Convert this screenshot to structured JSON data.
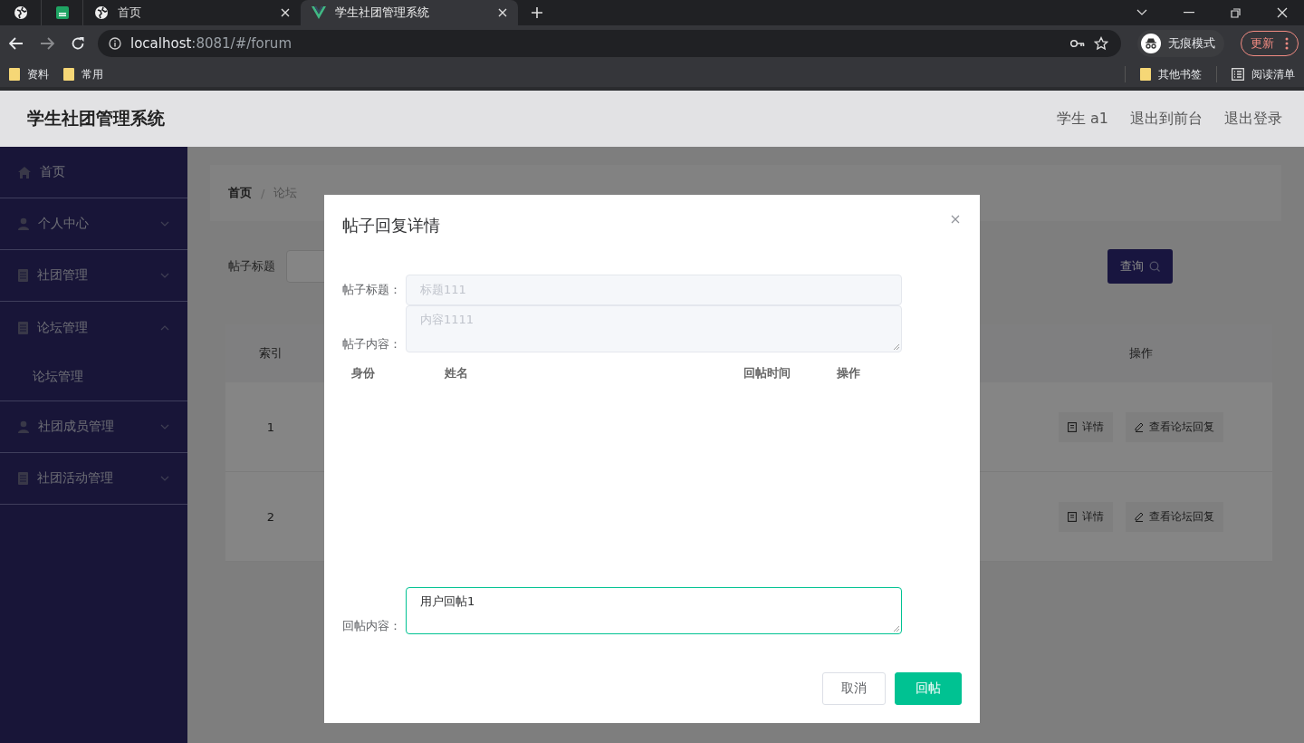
{
  "browser": {
    "tabs": [
      {
        "kind": "pinned-site",
        "selected": false
      },
      {
        "kind": "pinned-sheet",
        "selected": false
      },
      {
        "kind": "site",
        "label": "首页",
        "selected": false
      },
      {
        "kind": "app",
        "label": "学生社团管理系统",
        "selected": true
      }
    ],
    "url_host": "localhost",
    "url_rest": ":8081/#/forum",
    "profile": "无痕模式",
    "update": "更新",
    "bookmarks": [
      "资料",
      "常用"
    ],
    "bookmarks_right": [
      "其他书签"
    ],
    "reading_list": "阅读清单"
  },
  "app": {
    "title": "学生社团管理系统",
    "user_links": [
      "学生 a1",
      "退出到前台",
      "退出登录"
    ],
    "sidebar": [
      {
        "label": "首页",
        "kind": "home"
      },
      {
        "label": "个人中心",
        "kind": "user",
        "expanded": false
      },
      {
        "label": "社团管理",
        "kind": "document",
        "expanded": false
      },
      {
        "label": "论坛管理",
        "kind": "document",
        "expanded": true,
        "children": [
          {
            "label": "论坛管理"
          }
        ]
      },
      {
        "label": "社团成员管理",
        "kind": "user",
        "expanded": false
      },
      {
        "label": "社团活动管理",
        "kind": "document",
        "expanded": false
      }
    ],
    "breadcrumb": [
      "首页",
      "论坛"
    ],
    "breadcrumb_separator": "/",
    "search_label": "帖子标题",
    "search_button": "查询",
    "table": {
      "columns": [
        "索引",
        "操作"
      ],
      "rows": [
        {
          "index": "1",
          "actions": [
            "详情",
            "查看论坛回复"
          ]
        },
        {
          "index": "2",
          "actions": [
            "详情",
            "查看论坛回复"
          ]
        }
      ]
    }
  },
  "dialog": {
    "title": "帖子回复详情",
    "fields": [
      {
        "label": "帖子标题：",
        "value": "标题111",
        "kind": "input",
        "disabled": true
      },
      {
        "label": "帖子内容：",
        "value": "内容1111",
        "kind": "textarea",
        "disabled": true
      }
    ],
    "reply_columns": [
      "身份",
      "姓名",
      "回帖时间",
      "操作"
    ],
    "reply": {
      "label": "回帖内容：",
      "value": "用户回帖1",
      "focused": true
    },
    "buttons": [
      {
        "label": "取消",
        "kind": "default"
      },
      {
        "label": "回帖",
        "kind": "primary"
      }
    ]
  }
}
